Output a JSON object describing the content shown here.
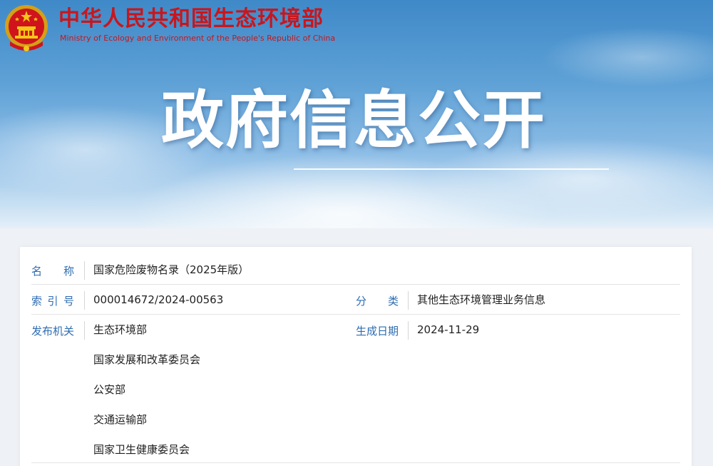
{
  "header": {
    "site_name_cn": "中华人民共和国生态环境部",
    "site_name_en": "Ministry of Ecology and Environment of the People's Republic of China",
    "banner_title": "政府信息公开"
  },
  "info": {
    "name_label": "名  称",
    "name_value": "国家危险废物名录（2025年版）",
    "index_label": "索 引 号",
    "index_value": "000014672/2024-00563",
    "category_label": "分  类",
    "category_value": "其他生态环境管理业务信息",
    "issuer_label": "发布机关",
    "issuers": [
      "生态环境部",
      "国家发展和改革委员会",
      "公安部",
      "交通运输部",
      "国家卫生健康委员会"
    ],
    "date_label": "生成日期",
    "date_value": "2024-11-29"
  },
  "colors": {
    "brand_red": "#c8161d",
    "label_blue": "#2e6cb0",
    "sky_blue": "#5ea1d6"
  }
}
